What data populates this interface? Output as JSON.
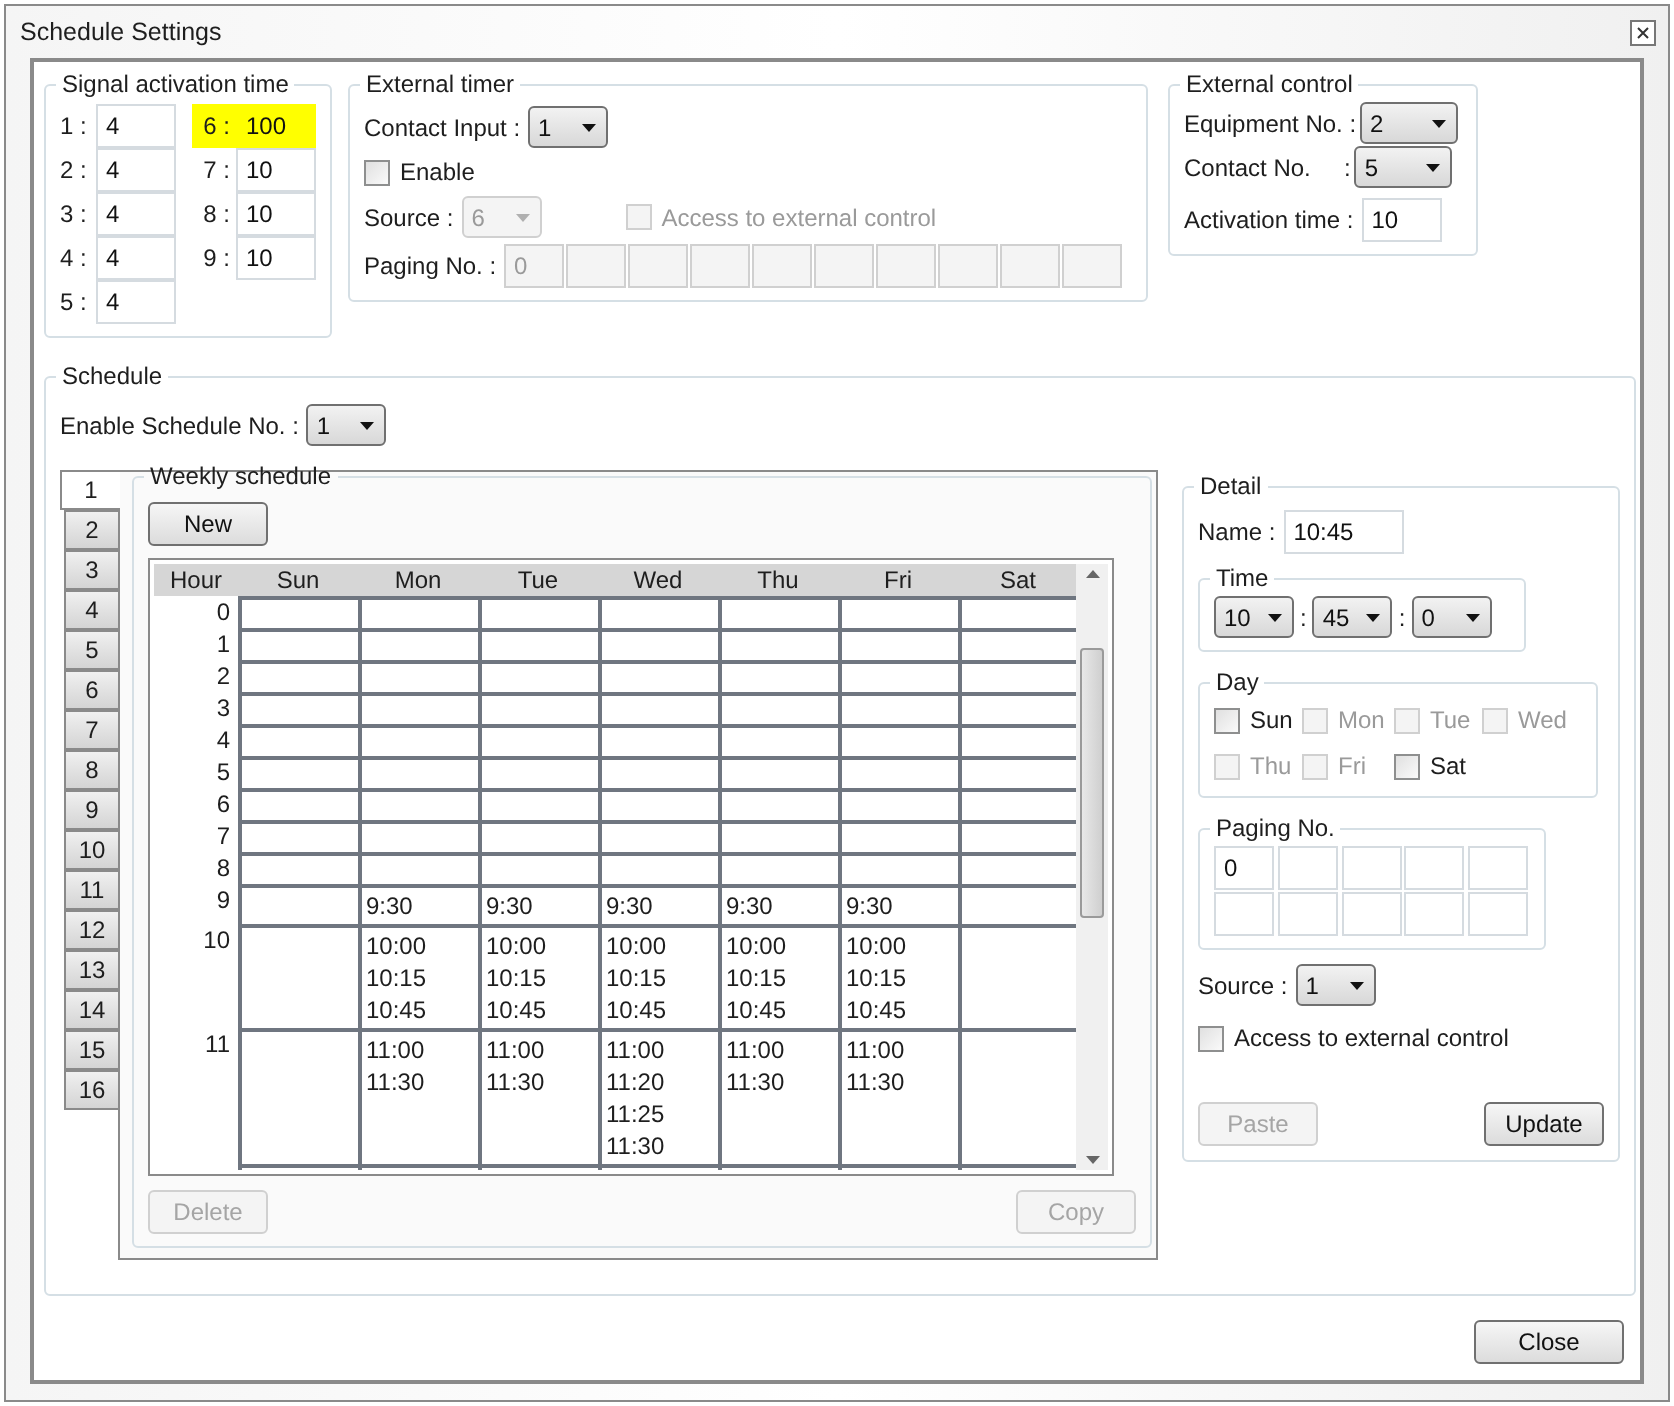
{
  "window": {
    "title": "Schedule Settings"
  },
  "signal_activation_time": {
    "title": "Signal activation time",
    "items": [
      {
        "label": "1 :",
        "value": "4",
        "highlighted": false
      },
      {
        "label": "2 :",
        "value": "4",
        "highlighted": false
      },
      {
        "label": "3 :",
        "value": "4",
        "highlighted": false
      },
      {
        "label": "4 :",
        "value": "4",
        "highlighted": false
      },
      {
        "label": "5 :",
        "value": "4",
        "highlighted": false
      },
      {
        "label": "6 :",
        "value": "100",
        "highlighted": true
      },
      {
        "label": "7 :",
        "value": "10",
        "highlighted": false
      },
      {
        "label": "8 :",
        "value": "10",
        "highlighted": false
      },
      {
        "label": "9 :",
        "value": "10",
        "highlighted": false
      }
    ]
  },
  "external_timer": {
    "title": "External timer",
    "contact_input": {
      "label": "Contact Input :",
      "value": "1"
    },
    "enable": {
      "label": "Enable",
      "checked": false
    },
    "source": {
      "label": "Source :",
      "value": "6",
      "disabled": true
    },
    "access": {
      "label": "Access to external control",
      "checked": false,
      "disabled": true
    },
    "paging": {
      "label": "Paging No. :",
      "values": [
        "0"
      ],
      "disabled": true
    }
  },
  "external_control": {
    "title": "External control",
    "equipment_no": {
      "label": "Equipment No. :",
      "value": "2"
    },
    "contact_no": {
      "label": "Contact No.     :",
      "value": "5"
    },
    "activation_time": {
      "label": "Activation time :",
      "value": "10"
    }
  },
  "schedule": {
    "title": "Schedule",
    "enable_schedule_no": {
      "label": "Enable Schedule No. :",
      "value": "1"
    },
    "tabs": [
      {
        "label": "1",
        "selected": true
      },
      {
        "label": "2",
        "selected": false
      },
      {
        "label": "3",
        "selected": false
      },
      {
        "label": "4",
        "selected": false
      },
      {
        "label": "5",
        "selected": false
      },
      {
        "label": "6",
        "selected": false
      },
      {
        "label": "7",
        "selected": false
      },
      {
        "label": "8",
        "selected": false
      },
      {
        "label": "9",
        "selected": false
      },
      {
        "label": "10",
        "selected": false
      },
      {
        "label": "11",
        "selected": false
      },
      {
        "label": "12",
        "selected": false
      },
      {
        "label": "13",
        "selected": false
      },
      {
        "label": "14",
        "selected": false
      },
      {
        "label": "15",
        "selected": false
      },
      {
        "label": "16",
        "selected": false
      }
    ],
    "weekly": {
      "title": "Weekly schedule",
      "new_button": "New",
      "delete_button": {
        "label": "Delete",
        "disabled": true
      },
      "copy_button": {
        "label": "Copy",
        "disabled": true
      },
      "hour_header": "Hour",
      "columns": [
        "Sun",
        "Mon",
        "Tue",
        "Wed",
        "Thu",
        "Fri",
        "Sat"
      ],
      "rows": [
        {
          "hour": "0",
          "cells": [
            [],
            [],
            [],
            [],
            [],
            [],
            []
          ]
        },
        {
          "hour": "1",
          "cells": [
            [],
            [],
            [],
            [],
            [],
            [],
            []
          ]
        },
        {
          "hour": "2",
          "cells": [
            [],
            [],
            [],
            [],
            [],
            [],
            []
          ]
        },
        {
          "hour": "3",
          "cells": [
            [],
            [],
            [],
            [],
            [],
            [],
            []
          ]
        },
        {
          "hour": "4",
          "cells": [
            [],
            [],
            [],
            [],
            [],
            [],
            []
          ]
        },
        {
          "hour": "5",
          "cells": [
            [],
            [],
            [],
            [],
            [],
            [],
            []
          ]
        },
        {
          "hour": "6",
          "cells": [
            [],
            [],
            [],
            [],
            [],
            [],
            []
          ]
        },
        {
          "hour": "7",
          "cells": [
            [],
            [],
            [],
            [],
            [],
            [],
            []
          ]
        },
        {
          "hour": "8",
          "cells": [
            [],
            [],
            [],
            [],
            [],
            [],
            []
          ]
        },
        {
          "hour": "9",
          "cells": [
            [],
            [
              "9:30"
            ],
            [
              "9:30"
            ],
            [
              "9:30"
            ],
            [
              "9:30"
            ],
            [
              "9:30"
            ],
            []
          ]
        },
        {
          "hour": "10",
          "cells": [
            [],
            [
              "10:00",
              "10:15",
              "10:45"
            ],
            [
              "10:00",
              "10:15",
              "10:45"
            ],
            [
              "10:00",
              "10:15",
              "10:45"
            ],
            [
              "10:00",
              "10:15",
              "10:45"
            ],
            [
              "10:00",
              "10:15",
              "10:45"
            ],
            []
          ]
        },
        {
          "hour": "11",
          "cells": [
            [],
            [
              "11:00",
              "11:30"
            ],
            [
              "11:00",
              "11:30"
            ],
            [
              "11:00",
              "11:20",
              "11:25",
              "11:30"
            ],
            [
              "11:00",
              "11:30"
            ],
            [
              "11:00",
              "11:30"
            ],
            []
          ]
        }
      ]
    },
    "detail": {
      "title": "Detail",
      "name": {
        "label": "Name :",
        "value": "10:45"
      },
      "time": {
        "title": "Time",
        "hour": "10",
        "minute": "45",
        "second": "0",
        "separator": ":"
      },
      "day": {
        "title": "Day",
        "days": [
          {
            "label": "Sun",
            "checked": false,
            "disabled": false
          },
          {
            "label": "Mon",
            "checked": false,
            "disabled": true
          },
          {
            "label": "Tue",
            "checked": false,
            "disabled": true
          },
          {
            "label": "Wed",
            "checked": false,
            "disabled": true
          },
          {
            "label": "Thu",
            "checked": false,
            "disabled": true
          },
          {
            "label": "Fri",
            "checked": false,
            "disabled": true
          },
          {
            "label": "Sat",
            "checked": false,
            "disabled": false
          }
        ]
      },
      "paging": {
        "title": "Paging No.",
        "values": [
          "0"
        ]
      },
      "source": {
        "label": "Source :",
        "value": "1"
      },
      "access": {
        "label": "Access to external control",
        "checked": false
      },
      "paste_button": {
        "label": "Paste",
        "disabled": true
      },
      "update_button": {
        "label": "Update",
        "disabled": false
      }
    }
  },
  "close_button": "Close"
}
